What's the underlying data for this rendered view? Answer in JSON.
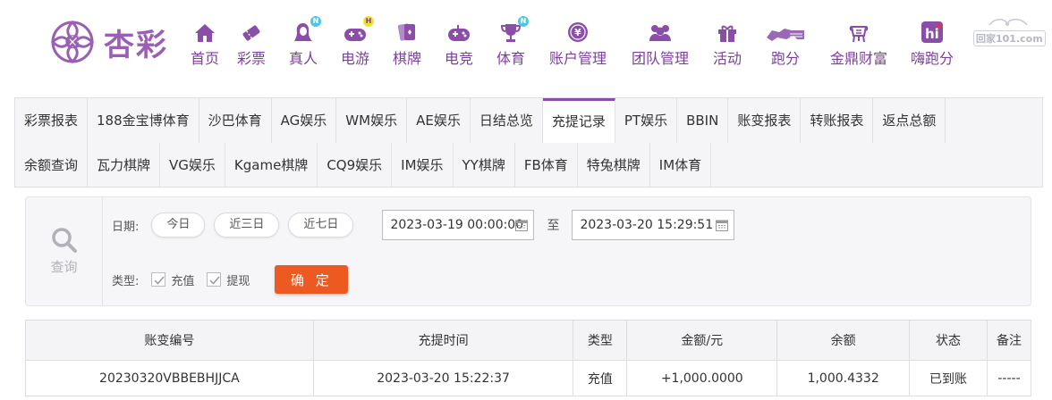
{
  "brand": {
    "name": "杏彩",
    "purple": "#8a4da8"
  },
  "nav": [
    {
      "label": "首页",
      "icon": "home-icon"
    },
    {
      "label": "彩票",
      "icon": "lottery-ticket-icon"
    },
    {
      "label": "真人",
      "icon": "live-dealer-icon",
      "badge": "N"
    },
    {
      "label": "电游",
      "icon": "slot-gamepad-icon",
      "badge": "H"
    },
    {
      "label": "棋牌",
      "icon": "cards-icon"
    },
    {
      "label": "电竞",
      "icon": "esports-gamepad-icon"
    },
    {
      "label": "体育",
      "icon": "trophy-icon",
      "badge": "N"
    },
    {
      "label": "账户管理",
      "icon": "yen-coin-icon"
    },
    {
      "label": "团队管理",
      "icon": "team-icon"
    },
    {
      "label": "活动",
      "icon": "gift-icon"
    },
    {
      "label": "跑分",
      "icon": "running-icon"
    },
    {
      "label": "金鼎财富",
      "icon": "tripod-icon"
    },
    {
      "label": "嗨跑分",
      "icon": "hi-app-icon"
    }
  ],
  "watermark": "回家101.com",
  "tabs": {
    "row1": [
      "彩票报表",
      "188金宝博体育",
      "沙巴体育",
      "AG娱乐",
      "WM娱乐",
      "AE娱乐",
      "日结总览",
      "充提记录",
      "PT娱乐",
      "BBIN",
      "账变报表",
      "转账报表",
      "返点总额"
    ],
    "row2": [
      "余额查询",
      "瓦力棋牌",
      "VG娱乐",
      "Kgame棋牌",
      "CQ9娱乐",
      "IM娱乐",
      "YY棋牌",
      "FB体育",
      "特兔棋牌",
      "IM体育"
    ],
    "active": "充提记录"
  },
  "filter": {
    "search_label": "查询",
    "date_label": "日期:",
    "quick": [
      "今日",
      "近三日",
      "近七日"
    ],
    "start": "2023-03-19 00:00:00",
    "to": "至",
    "end": "2023-03-20 15:29:51",
    "type_label": "类型:",
    "types": [
      {
        "label": "充值",
        "checked": true
      },
      {
        "label": "提现",
        "checked": true
      }
    ],
    "confirm": "确 定",
    "confirm_color": "#ec5a22"
  },
  "table": {
    "headers": [
      "账变编号",
      "充提时间",
      "类型",
      "金额/元",
      "余额",
      "状态",
      "备注"
    ],
    "rows": [
      [
        "20230320VBBEBHJJCA",
        "2023-03-20 15:22:37",
        "充值",
        "+1,000.0000",
        "1,000.4332",
        "已到账",
        "-----"
      ]
    ]
  }
}
